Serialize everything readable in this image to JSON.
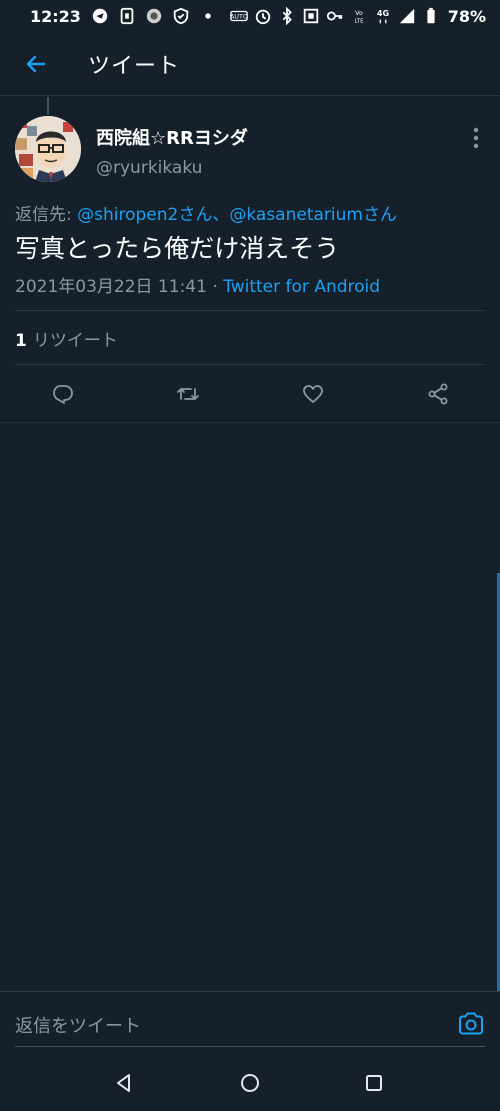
{
  "status_bar": {
    "time": "12:23",
    "battery": "78%",
    "left_icons": [
      "sync-icon",
      "sim-icon",
      "app-icon",
      "shield-icon",
      "dot-icon"
    ],
    "right_icons": [
      "auto-icon",
      "alarm-icon",
      "bluetooth-icon",
      "nfc-icon",
      "key-icon",
      "volte-icon",
      "4g-icon",
      "signal-icon",
      "battery-icon"
    ]
  },
  "header": {
    "title": "ツイート"
  },
  "tweet": {
    "display_name": "西院組☆RRヨシダ",
    "handle": "@ryurkikaku",
    "reply_prefix": "返信先: ",
    "reply_mention_1": "@shiropen2さん",
    "reply_separator": "、",
    "reply_mention_2": "@kasanetariumさん",
    "text": "写真とったら俺だけ消えそう",
    "timestamp": "2021年03月22日 11:41",
    "meta_separator": " · ",
    "source": "Twitter for Android",
    "retweet_count": "1",
    "retweet_label": "リツイート"
  },
  "reply_bar": {
    "placeholder": "返信をツイート"
  },
  "colors": {
    "background": "#15202b",
    "accent": "#1da1f2",
    "secondary_text": "#8899a6",
    "divider": "#2b3b4a"
  }
}
